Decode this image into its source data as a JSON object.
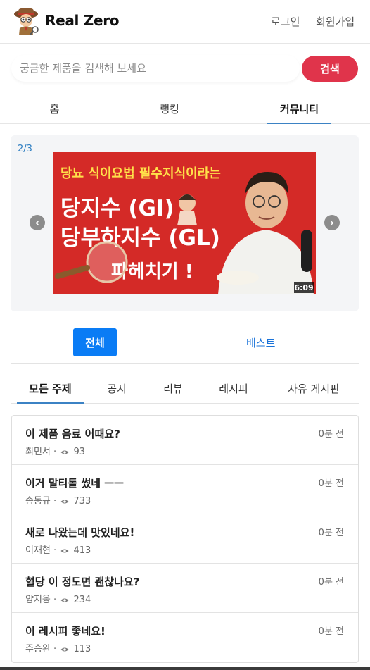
{
  "header": {
    "brand": "Real Zero",
    "login": "로그인",
    "signup": "회원가입"
  },
  "search": {
    "placeholder": "궁금한 제품을 검색해 보세요",
    "button": "검색"
  },
  "nav": {
    "tabs": [
      "홈",
      "랭킹",
      "커뮤니티"
    ],
    "active": "커뮤니티"
  },
  "banner": {
    "counter": "2/3",
    "line1": "당뇨 식이요법 필수지식이라는",
    "line2": "당지수 (GI)",
    "line3": "당부하지수 (GL)",
    "line4": "파헤치기 !",
    "duration": "6:09"
  },
  "filters": {
    "all": "전체",
    "best": "베스트"
  },
  "topics": [
    "모든 주제",
    "공지",
    "리뷰",
    "레시피",
    "자유 게시판"
  ],
  "posts": [
    {
      "title": "이 제품 음료 어때요?",
      "author": "최민서",
      "views": "93",
      "time": "0분 전"
    },
    {
      "title": "이거 말티톨 썼네 ㅡㅡ",
      "author": "송동규",
      "views": "733",
      "time": "0분 전"
    },
    {
      "title": "새로 나왔는데 맛있네요!",
      "author": "이재현",
      "views": "413",
      "time": "0분 전"
    },
    {
      "title": "혈당 이 정도면 괜찮나요?",
      "author": "양지웅",
      "views": "234",
      "time": "0분 전"
    },
    {
      "title": "이 레시피 좋네요!",
      "author": "주승완",
      "views": "113",
      "time": "0분 전"
    }
  ],
  "colors": {
    "accent_red": "#e0344b",
    "primary_blue": "#0a7cf5",
    "tab_underline": "#3b82c4"
  }
}
